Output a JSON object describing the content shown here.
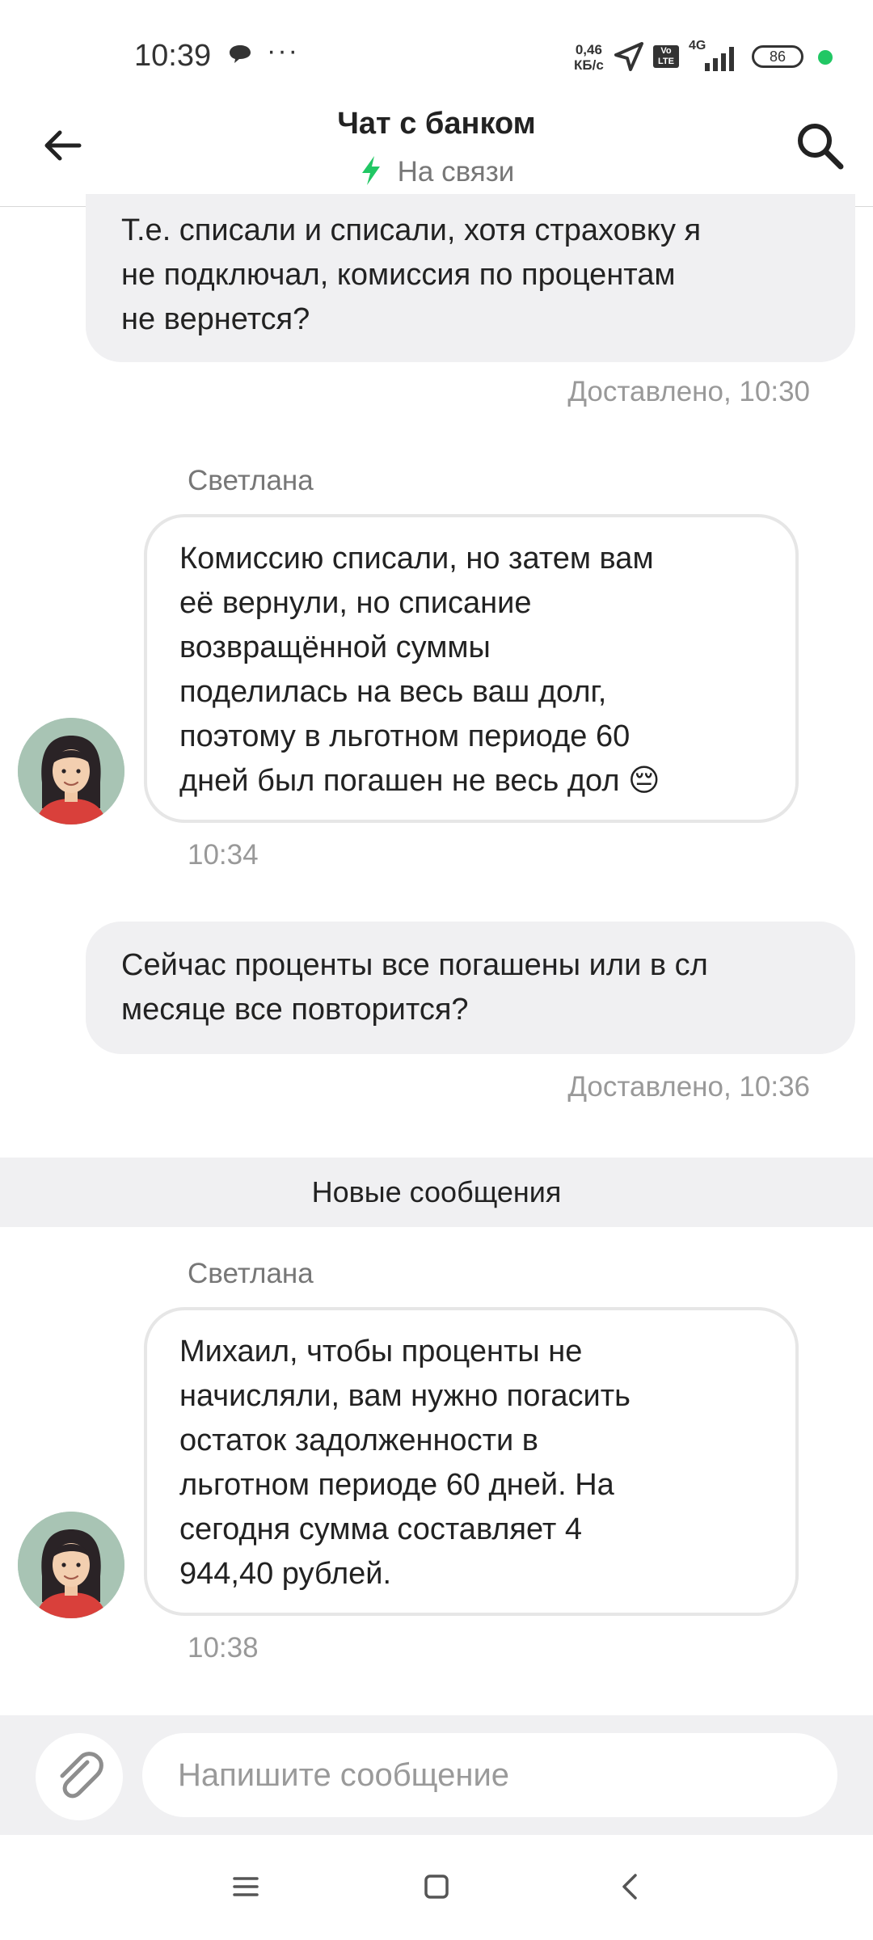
{
  "status_bar": {
    "time": "10:39",
    "overflow_indicator": "···",
    "network_speed_value": "0,46",
    "network_speed_unit": "КБ/с",
    "volte": "Vo LTE",
    "network_type": "4G",
    "battery": "86",
    "icons": [
      "chat-bubble-icon",
      "location-arrow-icon",
      "signal-bars-icon",
      "battery-icon",
      "green-dot-icon"
    ]
  },
  "header": {
    "title": "Чат с банком",
    "status": "На связи",
    "status_color": "#21c764",
    "icons": [
      "back-arrow-icon",
      "lightning-icon",
      "search-icon"
    ]
  },
  "messages": [
    {
      "direction": "out",
      "lines": [
        "Т.е. списали и списали, хотя страховку я",
        "не подключал, комиссия по процентам",
        "не вернется?"
      ],
      "meta": "Доставлено, 10:30"
    },
    {
      "direction": "in",
      "sender": "Светлана",
      "lines": [
        "Комиссию списали, но затем вам",
        "её вернули, но списание",
        "возвращённой суммы",
        "поделилась на весь ваш долг,",
        "поэтому в льготном периоде 60",
        "дней был погашен не весь дол 😔"
      ],
      "meta": "10:34"
    },
    {
      "direction": "out",
      "lines": [
        "Сейчас проценты все погашены или в сл",
        "месяце все повторится?"
      ],
      "meta": "Доставлено, 10:36"
    },
    {
      "direction": "in",
      "sender": "Светлана",
      "lines": [
        "Михаил, чтобы проценты не",
        "начисляли, вам нужно погасить",
        "остаток задолженности в",
        "льготном периоде 60 дней. На",
        "сегодня сумма составляет 4",
        "944,40 рублей."
      ],
      "meta": "10:38"
    }
  ],
  "divider": {
    "label": "Новые сообщения"
  },
  "composer": {
    "placeholder": "Напишите сообщение",
    "attach_icon": "paperclip-icon"
  },
  "nav_bar": {
    "icons": [
      "menu-icon",
      "home-square-icon",
      "back-chevron-icon"
    ]
  }
}
